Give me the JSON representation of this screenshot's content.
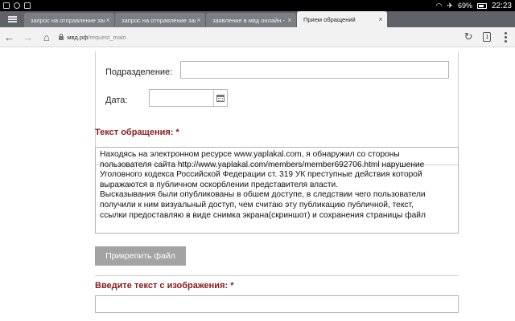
{
  "status_bar": {
    "time": "22:23",
    "battery": "69%"
  },
  "tabs": [
    {
      "label": "запрос на отправление зая"
    },
    {
      "label": "запрос на отправление зая"
    },
    {
      "label": "заявление в мвд онлайн -"
    },
    {
      "label": "Прием обращений"
    }
  ],
  "address_bar": {
    "domain": "мвд.рф",
    "path": "/request_main",
    "tab_count": "1"
  },
  "form": {
    "subdivision_label": "Подразделение:",
    "subdivision_value": "",
    "date_label": "Дата:",
    "date_value": "",
    "appeal_text_label": "Текст обращения: *",
    "appeal_text_lines": [
      "Находясь на электронном ресурсе www.yaplakal.com, я обнаружил со стороны",
      "пользователя сайта http://www.yaplakal.com/members/member692706.html нарушение",
      "Уголовного кодекса Российской Федерации ст. 319 УК преступные действия которой",
      "выражаются в публичном оскорблении представителя власти.",
      "Высказывания были опубликованы в обшем доступе, в следствии чего пользователи",
      "получили к ним визуальный доступ, чем считаю эту публикацию публичной, текст,",
      "ссылки предоставляю в виде снимка экрана(скриншот) и сохранения страницы файл"
    ],
    "attach_button": "Прикрепить файл",
    "captcha_label": "Введите текст с изображения: *",
    "captcha_value": ""
  },
  "colors": {
    "required_label": "#8b1a1a",
    "tab_strip": "#5f6368",
    "button_disabled": "#a3a3a3"
  }
}
